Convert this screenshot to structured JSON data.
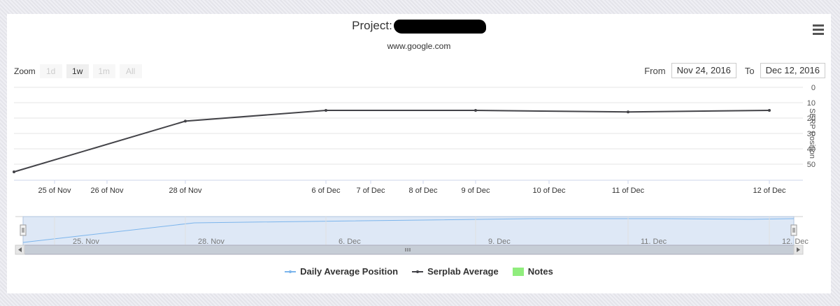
{
  "header": {
    "title_prefix": "Project:",
    "subtitle": "www.google.com"
  },
  "controls": {
    "zoom_label": "Zoom",
    "zoom_buttons": [
      "1d",
      "1w",
      "1m",
      "All"
    ],
    "zoom_active": "1w",
    "from_label": "From",
    "from_value": "Nov 24, 2016",
    "to_label": "To",
    "to_value": "Dec 12, 2016"
  },
  "icons": {
    "menu": "hamburger-menu-icon"
  },
  "colors": {
    "serplab": "#434348",
    "daily": "#7cb5ec",
    "notes": "#90ed7d",
    "navigator_fill": "#dae6f5"
  },
  "chart_data": {
    "type": "line",
    "y_axis": {
      "title": "SERP Position",
      "reversed": true,
      "range": [
        0,
        60
      ],
      "ticks": [
        0,
        10,
        20,
        30,
        40,
        50
      ],
      "opposite": true
    },
    "x_axis": {
      "range": [
        "2016-11-24",
        "2016-12-12"
      ],
      "tick_labels": [
        {
          "date": "2016-11-25",
          "label": "25 of Nov"
        },
        {
          "date": "2016-11-26",
          "label": "26 of Nov"
        },
        {
          "date": "2016-11-28",
          "label": "28 of Nov"
        },
        {
          "date": "2016-12-06",
          "label": "6 of Dec"
        },
        {
          "date": "2016-12-07",
          "label": "7 of Dec"
        },
        {
          "date": "2016-12-08",
          "label": "8 of Dec"
        },
        {
          "date": "2016-12-09",
          "label": "9 of Dec"
        },
        {
          "date": "2016-12-10",
          "label": "10 of Dec"
        },
        {
          "date": "2016-12-11",
          "label": "11 of Dec"
        },
        {
          "date": "2016-12-12",
          "label": "12 of Dec"
        }
      ]
    },
    "series": [
      {
        "name": "Serplab Average",
        "points": [
          {
            "x": "2016-11-24",
            "y": 55
          },
          {
            "x": "2016-11-28",
            "y": 22
          },
          {
            "x": "2016-12-06",
            "y": 15
          },
          {
            "x": "2016-12-09",
            "y": 15
          },
          {
            "x": "2016-12-11",
            "y": 16
          },
          {
            "x": "2016-12-12",
            "y": 15
          }
        ]
      }
    ],
    "navigator": {
      "tick_labels": [
        {
          "date": "2016-11-25",
          "label": "25. Nov"
        },
        {
          "date": "2016-11-28",
          "label": "28. Nov"
        },
        {
          "date": "2016-12-06",
          "label": "6. Dec"
        },
        {
          "date": "2016-12-09",
          "label": "9. Dec"
        },
        {
          "date": "2016-12-11",
          "label": "11. Dec"
        },
        {
          "date": "2016-12-12",
          "label": "12. Dec"
        }
      ]
    },
    "legend": {
      "placement": "bottom",
      "items": [
        {
          "name": "Daily Average Position",
          "kind": "line",
          "color": "#7cb5ec"
        },
        {
          "name": "Serplab Average",
          "kind": "line",
          "color": "#434348"
        },
        {
          "name": "Notes",
          "kind": "box",
          "color": "#90ed7d"
        }
      ]
    }
  }
}
